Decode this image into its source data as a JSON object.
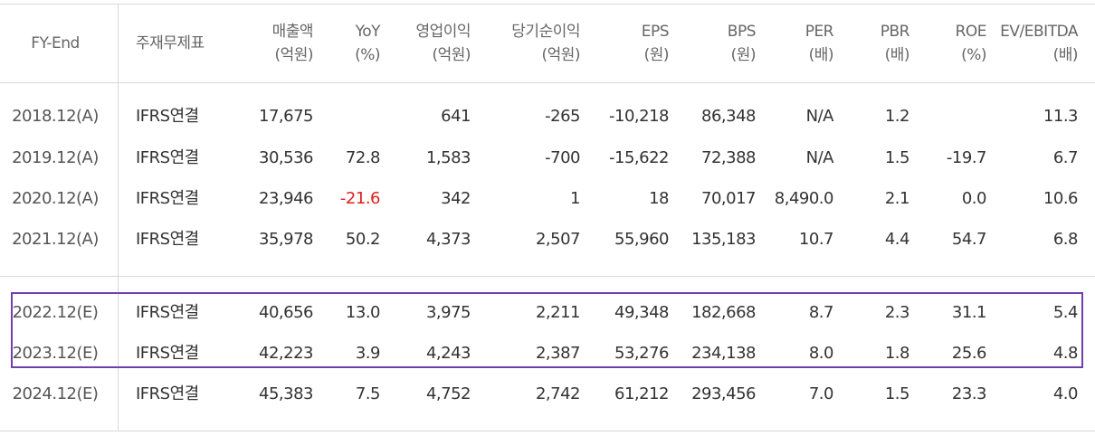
{
  "headers": [
    {
      "line1": "FY-End",
      "line2": ""
    },
    {
      "line1": "주재무제표",
      "line2": ""
    },
    {
      "line1": "매출액",
      "line2": "(억원)"
    },
    {
      "line1": "YoY",
      "line2": "(%)"
    },
    {
      "line1": "영업이익",
      "line2": "(억원)"
    },
    {
      "line1": "당기순이익",
      "line2": "(억원)"
    },
    {
      "line1": "EPS",
      "line2": "(원)"
    },
    {
      "line1": "BPS",
      "line2": "(원)"
    },
    {
      "line1": "PER",
      "line2": "(배)"
    },
    {
      "line1": "PBR",
      "line2": "(배)"
    },
    {
      "line1": "ROE",
      "line2": "(%)"
    },
    {
      "line1": "EV/EBITDA",
      "line2": "(배)"
    }
  ],
  "rows": [
    [
      "2018.12(A)",
      "IFRS연결",
      "17,675",
      "",
      "641",
      "-265",
      "-10,218",
      "86,348",
      "N/A",
      "1.2",
      "",
      "11.3"
    ],
    [
      "2019.12(A)",
      "IFRS연결",
      "30,536",
      "72.8",
      "1,583",
      "-700",
      "-15,622",
      "72,388",
      "N/A",
      "1.5",
      "-19.7",
      "6.7"
    ],
    [
      "2020.12(A)",
      "IFRS연결",
      "23,946",
      "-21.6",
      "342",
      "1",
      "18",
      "70,017",
      "8,490.0",
      "2.1",
      "0.0",
      "10.6"
    ],
    [
      "2021.12(A)",
      "IFRS연결",
      "35,978",
      "50.2",
      "4,373",
      "2,507",
      "55,960",
      "135,183",
      "10.7",
      "4.4",
      "54.7",
      "6.8"
    ],
    [
      "2022.12(E)",
      "IFRS연결",
      "40,656",
      "13.0",
      "3,975",
      "2,211",
      "49,348",
      "182,668",
      "8.7",
      "2.3",
      "31.1",
      "5.4"
    ],
    [
      "2023.12(E)",
      "IFRS연결",
      "42,223",
      "3.9",
      "4,243",
      "2,387",
      "53,276",
      "234,138",
      "8.0",
      "1.8",
      "25.6",
      "4.8"
    ],
    [
      "2024.12(E)",
      "IFRS연결",
      "45,383",
      "7.5",
      "4,752",
      "2,742",
      "61,212",
      "293,456",
      "7.0",
      "1.5",
      "23.3",
      "4.0"
    ]
  ],
  "negative_color": "#e0201b",
  "highlight_color": "#6f3fb0"
}
